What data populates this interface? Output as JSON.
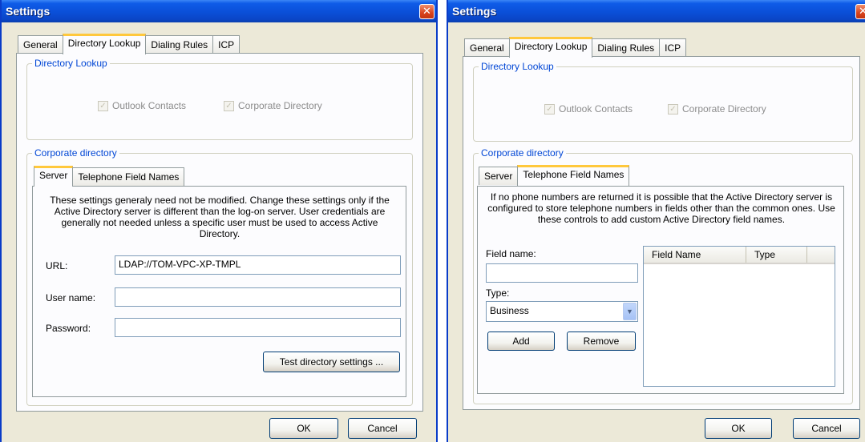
{
  "left": {
    "title": "Settings",
    "tabs": [
      "General",
      "Directory Lookup",
      "Dialing Rules",
      "ICP"
    ],
    "directory_lookup": {
      "legend": "Directory Lookup",
      "outlook_contacts": "Outlook Contacts",
      "corporate_directory": "Corporate Directory"
    },
    "corporate": {
      "legend": "Corporate directory",
      "subtabs": [
        "Server",
        "Telephone Field Names"
      ],
      "description": "These settings generaly need not be modified.  Change these settings only if the Active Directory server is different than the log-on server.  User credentials are generally not needed unless a specific user must be used to access Active Directory.",
      "url_label": "URL:",
      "url_value": "LDAP://TOM-VPC-XP-TMPL",
      "username_label": "User name:",
      "username_value": "",
      "password_label": "Password:",
      "password_value": "",
      "test_button": "Test directory settings ..."
    },
    "ok": "OK",
    "cancel": "Cancel"
  },
  "right": {
    "title": "Settings",
    "tabs": [
      "General",
      "Directory Lookup",
      "Dialing Rules",
      "ICP"
    ],
    "directory_lookup": {
      "legend": "Directory Lookup",
      "outlook_contacts": "Outlook Contacts",
      "corporate_directory": "Corporate Directory"
    },
    "corporate": {
      "legend": "Corporate directory",
      "subtabs": [
        "Server",
        "Telephone Field Names"
      ],
      "description": "If no phone numbers are returned it is possible that the Active Directory server is configured to store telephone numbers in fields other than the common ones.  Use these controls to add custom Active Directory field names.",
      "field_name_label": "Field name:",
      "field_name_value": "",
      "type_label": "Type:",
      "type_value": "Business",
      "add_button": "Add",
      "remove_button": "Remove",
      "columns": [
        "Field Name",
        "Type"
      ]
    },
    "ok": "OK",
    "cancel": "Cancel"
  },
  "colors": {
    "titlebar": "#0a4fd8",
    "dialog_bg": "#ece9d8",
    "legend": "#0046d5",
    "tab_accent": "#ffc83c"
  }
}
